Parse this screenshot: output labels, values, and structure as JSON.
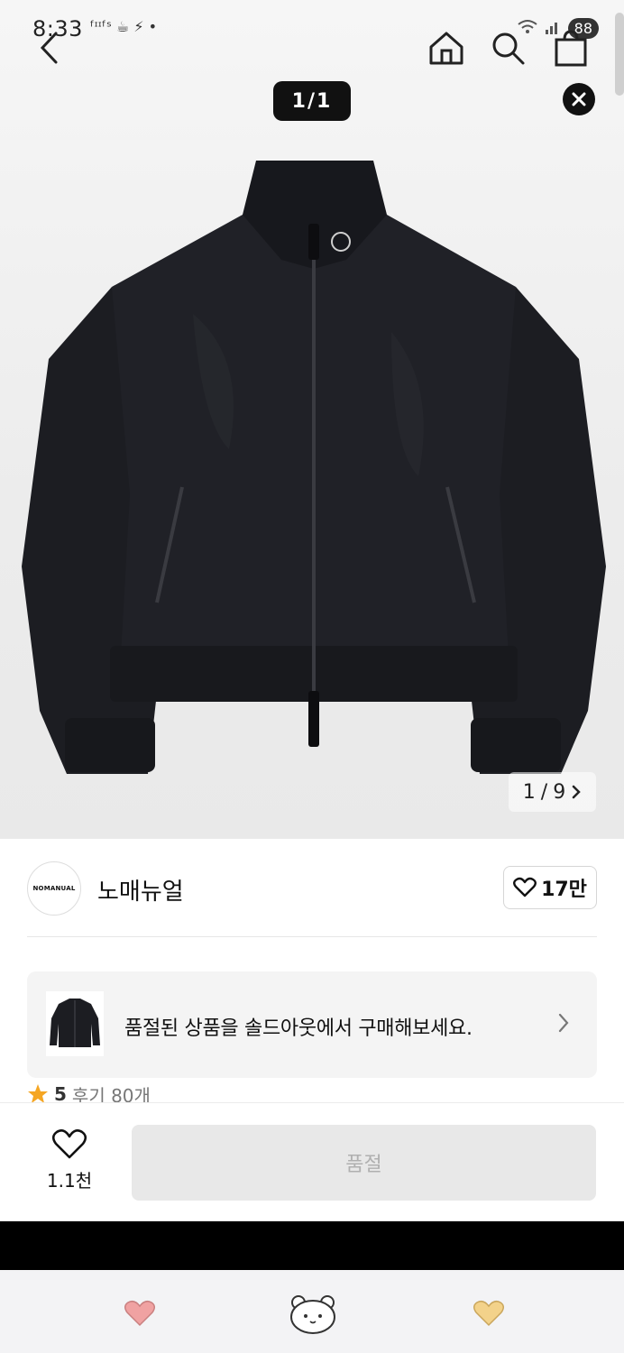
{
  "status_bar": {
    "time": "8:33",
    "left_icons": "ᶠᶦᶦᶠˢ ☕ ⚡ •",
    "signal_text": "⁶",
    "battery": "88"
  },
  "nav": {
    "back_icon": "chevron-left-icon",
    "home_icon": "home-icon",
    "search_icon": "search-icon",
    "cart_icon": "bag-icon"
  },
  "gallery": {
    "viewer_counter": "1/1",
    "page_current": "1",
    "page_sep": "/",
    "page_total": "9",
    "product_image": "black zip-up track jacket"
  },
  "brand": {
    "logo_text": "NOMANUAL",
    "name": "노매뉴얼",
    "like_count": "17만"
  },
  "soldout_banner": {
    "message": "품절된 상품을 솔드아웃에서 구매해보세요."
  },
  "rating": {
    "score": "5",
    "review_label": "후기 80개"
  },
  "bottom_bar": {
    "wish_count": "1.1천",
    "soldout_label": "품절"
  },
  "tab_bar": {
    "left": "heart-pink-icon",
    "center": "bear-face-icon",
    "right": "heart-yellow-icon"
  },
  "colors": {
    "accent_star": "#f5a623",
    "soldout_bg": "#e8e8e8",
    "soldout_text": "#b0b0b0",
    "heart_pink": "#f0a2a2",
    "heart_yellow": "#f3d28a"
  }
}
